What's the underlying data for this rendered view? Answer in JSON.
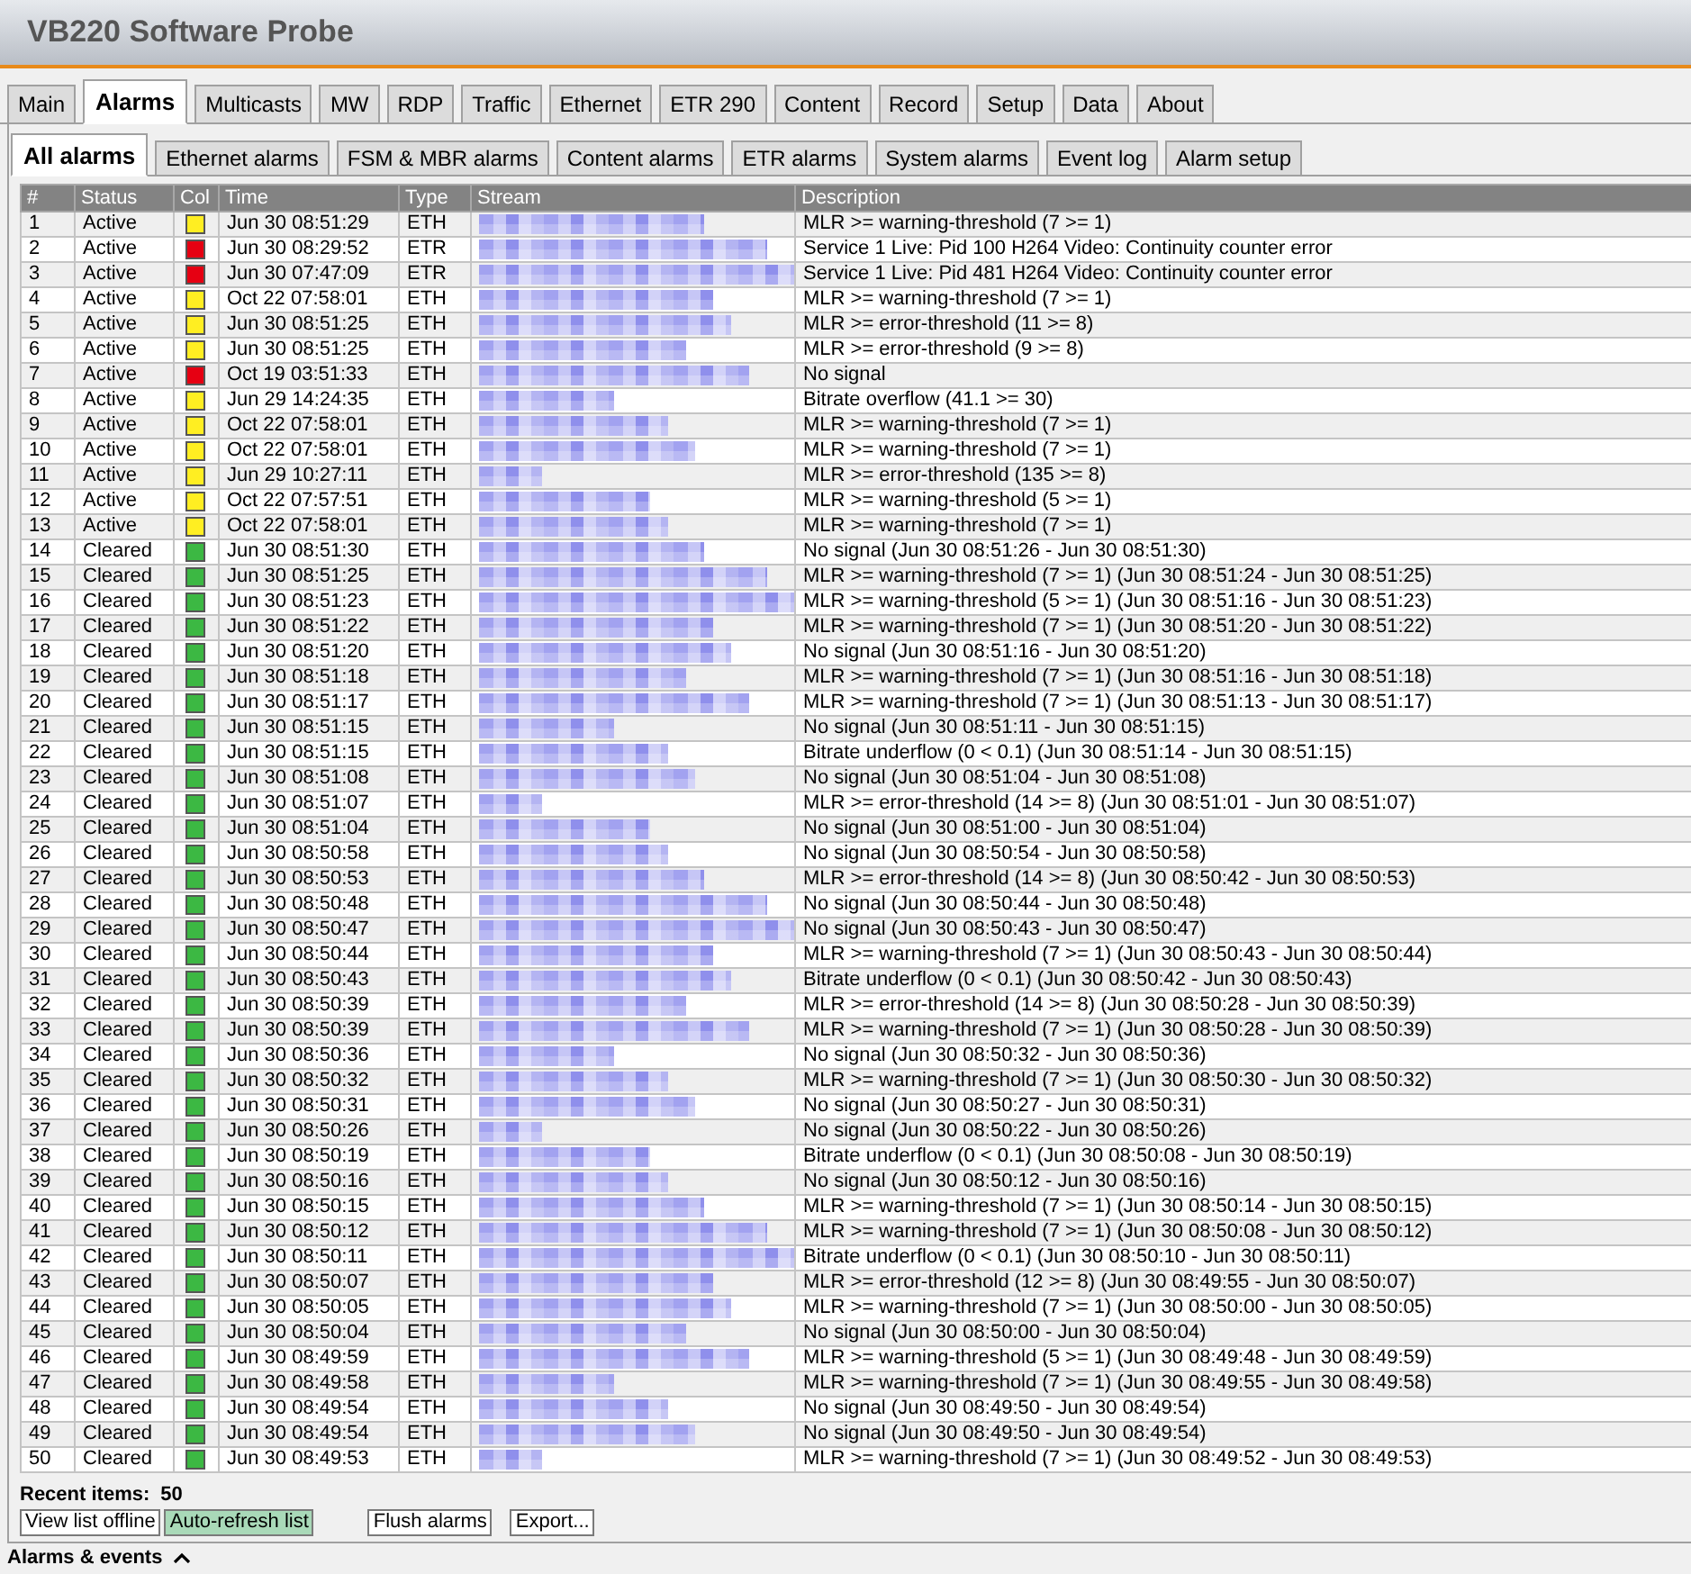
{
  "header": {
    "title": "VB220 Software Probe"
  },
  "main_tabs": [
    {
      "label": "Main",
      "selected": false
    },
    {
      "label": "Alarms",
      "selected": true
    },
    {
      "label": "Multicasts",
      "selected": false
    },
    {
      "label": "MW",
      "selected": false
    },
    {
      "label": "RDP",
      "selected": false
    },
    {
      "label": "Traffic",
      "selected": false
    },
    {
      "label": "Ethernet",
      "selected": false
    },
    {
      "label": "ETR 290",
      "selected": false
    },
    {
      "label": "Content",
      "selected": false
    },
    {
      "label": "Record",
      "selected": false
    },
    {
      "label": "Setup",
      "selected": false
    },
    {
      "label": "Data",
      "selected": false
    },
    {
      "label": "About",
      "selected": false
    }
  ],
  "sub_tabs": [
    {
      "label": "All alarms",
      "selected": true
    },
    {
      "label": "Ethernet alarms",
      "selected": false
    },
    {
      "label": "FSM & MBR alarms",
      "selected": false
    },
    {
      "label": "Content alarms",
      "selected": false
    },
    {
      "label": "ETR alarms",
      "selected": false
    },
    {
      "label": "System alarms",
      "selected": false
    },
    {
      "label": "Event log",
      "selected": false
    },
    {
      "label": "Alarm setup",
      "selected": false
    }
  ],
  "table": {
    "columns": [
      "#",
      "Status",
      "Col",
      "Time",
      "Type",
      "Stream",
      "Description"
    ],
    "rows": [
      {
        "number": "1",
        "status": "Active",
        "color": "#ffee22",
        "time": "Jun 30 08:51:29",
        "type": "ETH",
        "description": "MLR >= warning-threshold (7 >= 1)"
      },
      {
        "number": "2",
        "status": "Active",
        "color": "#e60012",
        "time": "Jun 30 08:29:52",
        "type": "ETR",
        "description": "Service 1 Live: Pid 100 H264 Video: Continuity counter error"
      },
      {
        "number": "3",
        "status": "Active",
        "color": "#e60012",
        "time": "Jun 30 07:47:09",
        "type": "ETR",
        "description": "Service 1 Live: Pid 481 H264 Video: Continuity counter error"
      },
      {
        "number": "4",
        "status": "Active",
        "color": "#ffee22",
        "time": "Oct 22 07:58:01",
        "type": "ETH",
        "description": "MLR >= warning-threshold (7 >= 1)"
      },
      {
        "number": "5",
        "status": "Active",
        "color": "#ffee22",
        "time": "Jun 30 08:51:25",
        "type": "ETH",
        "description": "MLR >= error-threshold (11 >= 8)"
      },
      {
        "number": "6",
        "status": "Active",
        "color": "#ffee22",
        "time": "Jun 30 08:51:25",
        "type": "ETH",
        "description": "MLR >= error-threshold (9 >= 8)"
      },
      {
        "number": "7",
        "status": "Active",
        "color": "#e60012",
        "time": "Oct 19 03:51:33",
        "type": "ETH",
        "description": "No signal"
      },
      {
        "number": "8",
        "status": "Active",
        "color": "#ffee22",
        "time": "Jun 29 14:24:35",
        "type": "ETH",
        "description": "Bitrate overflow (41.1 >= 30)"
      },
      {
        "number": "9",
        "status": "Active",
        "color": "#ffee22",
        "time": "Oct 22 07:58:01",
        "type": "ETH",
        "description": "MLR >= warning-threshold (7 >= 1)"
      },
      {
        "number": "10",
        "status": "Active",
        "color": "#ffee22",
        "time": "Oct 22 07:58:01",
        "type": "ETH",
        "description": "MLR >= warning-threshold (7 >= 1)"
      },
      {
        "number": "11",
        "status": "Active",
        "color": "#ffee22",
        "time": "Jun 29 10:27:11",
        "type": "ETH",
        "description": "MLR >= error-threshold (135 >= 8)"
      },
      {
        "number": "12",
        "status": "Active",
        "color": "#ffee22",
        "time": "Oct 22 07:57:51",
        "type": "ETH",
        "description": "MLR >= warning-threshold (5 >= 1)"
      },
      {
        "number": "13",
        "status": "Active",
        "color": "#ffee22",
        "time": "Oct 22 07:58:01",
        "type": "ETH",
        "description": "MLR >= warning-threshold (7 >= 1)"
      },
      {
        "number": "14",
        "status": "Cleared",
        "color": "#3cb843",
        "time": "Jun 30 08:51:30",
        "type": "ETH",
        "description": "No signal (Jun 30 08:51:26 - Jun 30 08:51:30)"
      },
      {
        "number": "15",
        "status": "Cleared",
        "color": "#3cb843",
        "time": "Jun 30 08:51:25",
        "type": "ETH",
        "description": "MLR >= warning-threshold (7 >= 1) (Jun 30 08:51:24 - Jun 30 08:51:25)"
      },
      {
        "number": "16",
        "status": "Cleared",
        "color": "#3cb843",
        "time": "Jun 30 08:51:23",
        "type": "ETH",
        "description": "MLR >= warning-threshold (5 >= 1) (Jun 30 08:51:16 - Jun 30 08:51:23)"
      },
      {
        "number": "17",
        "status": "Cleared",
        "color": "#3cb843",
        "time": "Jun 30 08:51:22",
        "type": "ETH",
        "description": "MLR >= warning-threshold (7 >= 1) (Jun 30 08:51:20 - Jun 30 08:51:22)"
      },
      {
        "number": "18",
        "status": "Cleared",
        "color": "#3cb843",
        "time": "Jun 30 08:51:20",
        "type": "ETH",
        "description": "No signal (Jun 30 08:51:16 - Jun 30 08:51:20)"
      },
      {
        "number": "19",
        "status": "Cleared",
        "color": "#3cb843",
        "time": "Jun 30 08:51:18",
        "type": "ETH",
        "description": "MLR >= warning-threshold (7 >= 1) (Jun 30 08:51:16 - Jun 30 08:51:18)"
      },
      {
        "number": "20",
        "status": "Cleared",
        "color": "#3cb843",
        "time": "Jun 30 08:51:17",
        "type": "ETH",
        "description": "MLR >= warning-threshold (7 >= 1) (Jun 30 08:51:13 - Jun 30 08:51:17)"
      },
      {
        "number": "21",
        "status": "Cleared",
        "color": "#3cb843",
        "time": "Jun 30 08:51:15",
        "type": "ETH",
        "description": "No signal (Jun 30 08:51:11 - Jun 30 08:51:15)"
      },
      {
        "number": "22",
        "status": "Cleared",
        "color": "#3cb843",
        "time": "Jun 30 08:51:15",
        "type": "ETH",
        "description": "Bitrate underflow (0 < 0.1) (Jun 30 08:51:14 - Jun 30 08:51:15)"
      },
      {
        "number": "23",
        "status": "Cleared",
        "color": "#3cb843",
        "time": "Jun 30 08:51:08",
        "type": "ETH",
        "description": "No signal (Jun 30 08:51:04 - Jun 30 08:51:08)"
      },
      {
        "number": "24",
        "status": "Cleared",
        "color": "#3cb843",
        "time": "Jun 30 08:51:07",
        "type": "ETH",
        "description": "MLR >= error-threshold (14 >= 8) (Jun 30 08:51:01 - Jun 30 08:51:07)"
      },
      {
        "number": "25",
        "status": "Cleared",
        "color": "#3cb843",
        "time": "Jun 30 08:51:04",
        "type": "ETH",
        "description": "No signal (Jun 30 08:51:00 - Jun 30 08:51:04)"
      },
      {
        "number": "26",
        "status": "Cleared",
        "color": "#3cb843",
        "time": "Jun 30 08:50:58",
        "type": "ETH",
        "description": "No signal (Jun 30 08:50:54 - Jun 30 08:50:58)"
      },
      {
        "number": "27",
        "status": "Cleared",
        "color": "#3cb843",
        "time": "Jun 30 08:50:53",
        "type": "ETH",
        "description": "MLR >= error-threshold (14 >= 8) (Jun 30 08:50:42 - Jun 30 08:50:53)"
      },
      {
        "number": "28",
        "status": "Cleared",
        "color": "#3cb843",
        "time": "Jun 30 08:50:48",
        "type": "ETH",
        "description": "No signal (Jun 30 08:50:44 - Jun 30 08:50:48)"
      },
      {
        "number": "29",
        "status": "Cleared",
        "color": "#3cb843",
        "time": "Jun 30 08:50:47",
        "type": "ETH",
        "description": "No signal (Jun 30 08:50:43 - Jun 30 08:50:47)"
      },
      {
        "number": "30",
        "status": "Cleared",
        "color": "#3cb843",
        "time": "Jun 30 08:50:44",
        "type": "ETH",
        "description": "MLR >= warning-threshold (7 >= 1) (Jun 30 08:50:43 - Jun 30 08:50:44)"
      },
      {
        "number": "31",
        "status": "Cleared",
        "color": "#3cb843",
        "time": "Jun 30 08:50:43",
        "type": "ETH",
        "description": "Bitrate underflow (0 < 0.1) (Jun 30 08:50:42 - Jun 30 08:50:43)"
      },
      {
        "number": "32",
        "status": "Cleared",
        "color": "#3cb843",
        "time": "Jun 30 08:50:39",
        "type": "ETH",
        "description": "MLR >= error-threshold (14 >= 8) (Jun 30 08:50:28 - Jun 30 08:50:39)"
      },
      {
        "number": "33",
        "status": "Cleared",
        "color": "#3cb843",
        "time": "Jun 30 08:50:39",
        "type": "ETH",
        "description": "MLR >= warning-threshold (7 >= 1) (Jun 30 08:50:28 - Jun 30 08:50:39)"
      },
      {
        "number": "34",
        "status": "Cleared",
        "color": "#3cb843",
        "time": "Jun 30 08:50:36",
        "type": "ETH",
        "description": "No signal (Jun 30 08:50:32 - Jun 30 08:50:36)"
      },
      {
        "number": "35",
        "status": "Cleared",
        "color": "#3cb843",
        "time": "Jun 30 08:50:32",
        "type": "ETH",
        "description": "MLR >= warning-threshold (7 >= 1) (Jun 30 08:50:30 - Jun 30 08:50:32)"
      },
      {
        "number": "36",
        "status": "Cleared",
        "color": "#3cb843",
        "time": "Jun 30 08:50:31",
        "type": "ETH",
        "description": "No signal (Jun 30 08:50:27 - Jun 30 08:50:31)"
      },
      {
        "number": "37",
        "status": "Cleared",
        "color": "#3cb843",
        "time": "Jun 30 08:50:26",
        "type": "ETH",
        "description": "No signal (Jun 30 08:50:22 - Jun 30 08:50:26)"
      },
      {
        "number": "38",
        "status": "Cleared",
        "color": "#3cb843",
        "time": "Jun 30 08:50:19",
        "type": "ETH",
        "description": "Bitrate underflow (0 < 0.1) (Jun 30 08:50:08 - Jun 30 08:50:19)"
      },
      {
        "number": "39",
        "status": "Cleared",
        "color": "#3cb843",
        "time": "Jun 30 08:50:16",
        "type": "ETH",
        "description": "No signal (Jun 30 08:50:12 - Jun 30 08:50:16)"
      },
      {
        "number": "40",
        "status": "Cleared",
        "color": "#3cb843",
        "time": "Jun 30 08:50:15",
        "type": "ETH",
        "description": "MLR >= warning-threshold (7 >= 1) (Jun 30 08:50:14 - Jun 30 08:50:15)"
      },
      {
        "number": "41",
        "status": "Cleared",
        "color": "#3cb843",
        "time": "Jun 30 08:50:12",
        "type": "ETH",
        "description": "MLR >= warning-threshold (7 >= 1) (Jun 30 08:50:08 - Jun 30 08:50:12)"
      },
      {
        "number": "42",
        "status": "Cleared",
        "color": "#3cb843",
        "time": "Jun 30 08:50:11",
        "type": "ETH",
        "description": "Bitrate underflow (0 < 0.1) (Jun 30 08:50:10 - Jun 30 08:50:11)"
      },
      {
        "number": "43",
        "status": "Cleared",
        "color": "#3cb843",
        "time": "Jun 30 08:50:07",
        "type": "ETH",
        "description": "MLR >= error-threshold (12 >= 8) (Jun 30 08:49:55 - Jun 30 08:50:07)"
      },
      {
        "number": "44",
        "status": "Cleared",
        "color": "#3cb843",
        "time": "Jun 30 08:50:05",
        "type": "ETH",
        "description": "MLR >= warning-threshold (7 >= 1) (Jun 30 08:50:00 - Jun 30 08:50:05)"
      },
      {
        "number": "45",
        "status": "Cleared",
        "color": "#3cb843",
        "time": "Jun 30 08:50:04",
        "type": "ETH",
        "description": "No signal (Jun 30 08:50:00 - Jun 30 08:50:04)"
      },
      {
        "number": "46",
        "status": "Cleared",
        "color": "#3cb843",
        "time": "Jun 30 08:49:59",
        "type": "ETH",
        "description": "MLR >= warning-threshold (5 >= 1) (Jun 30 08:49:48 - Jun 30 08:49:59)"
      },
      {
        "number": "47",
        "status": "Cleared",
        "color": "#3cb843",
        "time": "Jun 30 08:49:58",
        "type": "ETH",
        "description": "MLR >= warning-threshold (7 >= 1) (Jun 30 08:49:55 - Jun 30 08:49:58)"
      },
      {
        "number": "48",
        "status": "Cleared",
        "color": "#3cb843",
        "time": "Jun 30 08:49:54",
        "type": "ETH",
        "description": "No signal (Jun 30 08:49:50 - Jun 30 08:49:54)"
      },
      {
        "number": "49",
        "status": "Cleared",
        "color": "#3cb843",
        "time": "Jun 30 08:49:54",
        "type": "ETH",
        "description": "No signal (Jun 30 08:49:50 - Jun 30 08:49:54)"
      },
      {
        "number": "50",
        "status": "Cleared",
        "color": "#3cb843",
        "time": "Jun 30 08:49:53",
        "type": "ETH",
        "description": "MLR >= warning-threshold (7 >= 1) (Jun 30 08:49:52 - Jun 30 08:49:53)"
      }
    ]
  },
  "recent_items": {
    "label": "Recent items:",
    "count": "50"
  },
  "list_buttons": [
    {
      "label": "View list offline",
      "on": false
    },
    {
      "label": "Auto-refresh list",
      "on": true
    }
  ],
  "action_buttons": [
    {
      "label": "Flush alarms"
    },
    {
      "label": "Export..."
    }
  ],
  "footer": {
    "title": "Alarms & events"
  }
}
